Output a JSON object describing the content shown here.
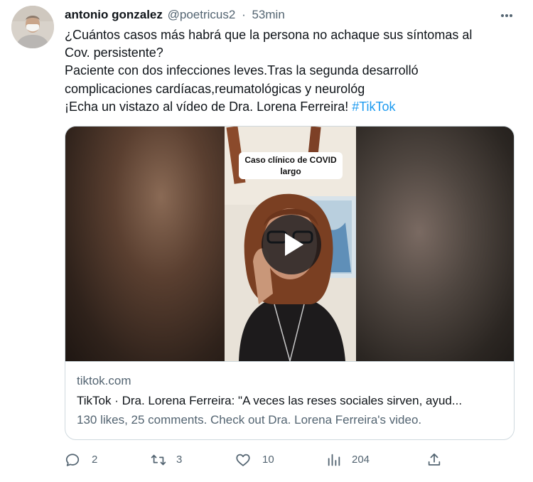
{
  "tweet": {
    "author_name": "antonio gonzalez",
    "author_handle": "@poetricus2",
    "separator": "·",
    "time": "53min",
    "text_lines": [
      "¿Cuántos casos más habrá que la persona no achaque sus síntomas al",
      "Cov. persistente?",
      "Paciente con dos infecciones leves.Tras la segunda desarrolló",
      "complicaciones cardíacas,reumatológicas y neurológ",
      "¡Echa un vistazo al vídeo de Dra. Lorena Ferreira! "
    ],
    "hashtag": "#TikTok"
  },
  "card": {
    "video_caption": "Caso clínico de COVID largo",
    "domain": "tiktok.com",
    "title": "TikTok · Dra. Lorena Ferreira: \"A veces las reses sociales sirven, ayud...",
    "description": "130 likes, 25 comments. Check out Dra. Lorena Ferreira's video."
  },
  "actions": {
    "replies": "2",
    "retweets": "3",
    "likes": "10",
    "views": "204"
  },
  "icons": {
    "more": "more-dots-icon",
    "reply": "reply-icon",
    "retweet": "retweet-icon",
    "like": "heart-icon",
    "views": "views-bar-chart-icon",
    "share": "share-icon",
    "play": "play-icon"
  },
  "colors": {
    "text": "#0f1419",
    "secondary": "#536471",
    "link": "#1d9bf0",
    "border": "#cfd9de"
  }
}
